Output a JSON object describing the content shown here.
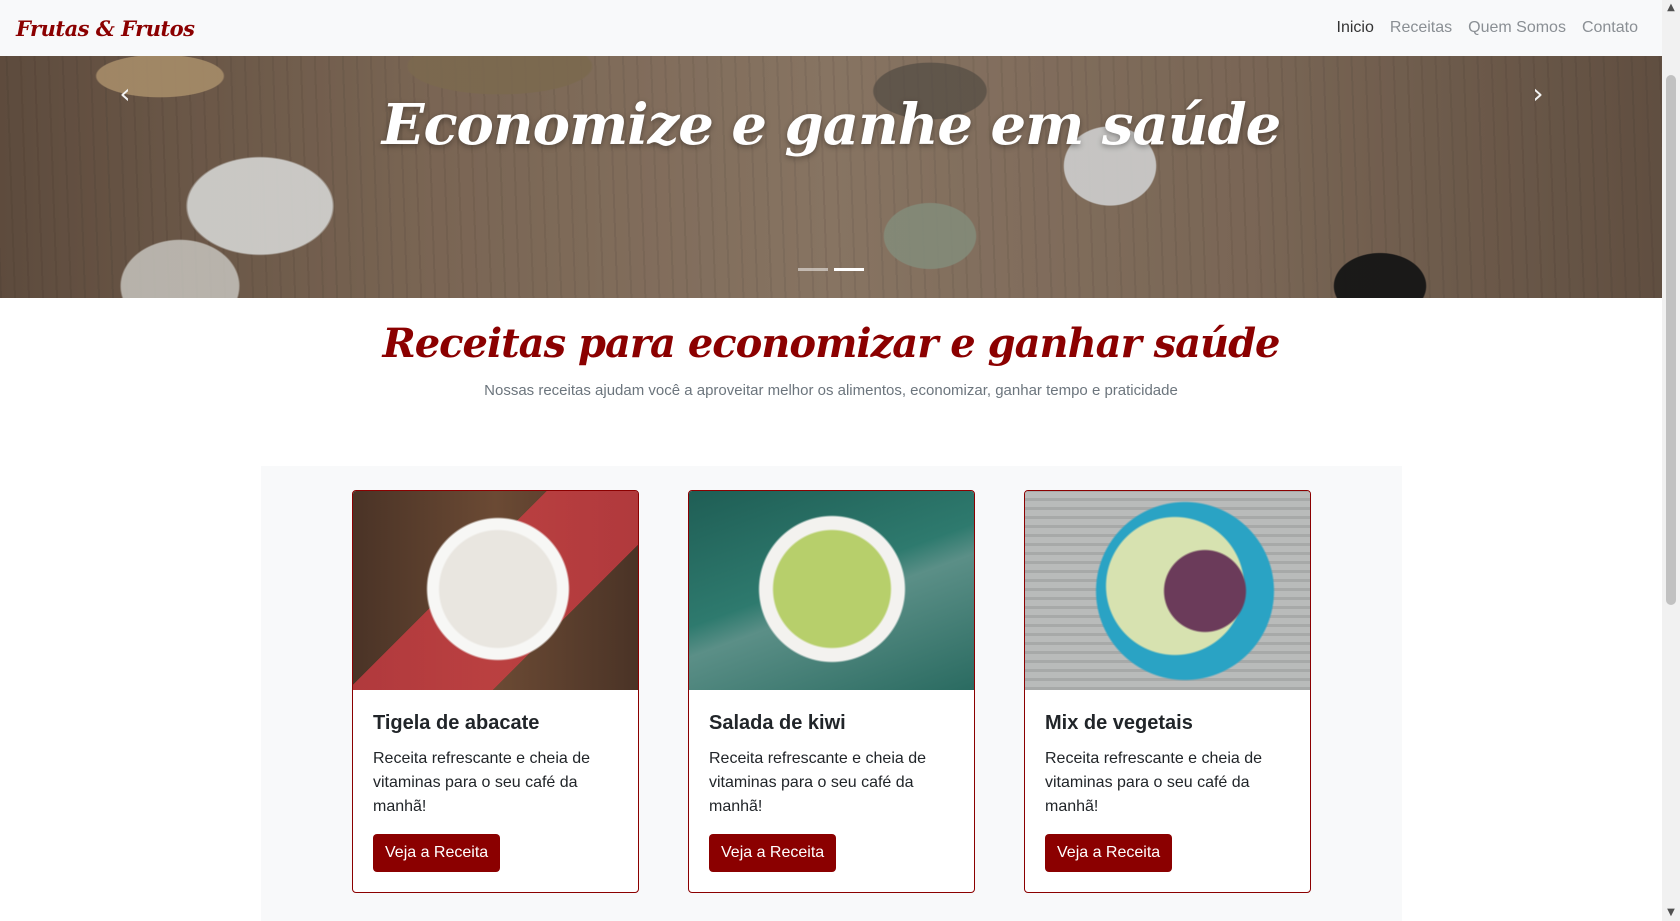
{
  "navbar": {
    "brand": "Frutas & Frutos",
    "links": [
      "Inicio",
      "Receitas",
      "Quem Somos",
      "Contato"
    ],
    "active_index": 0
  },
  "hero": {
    "title": "Economize e ganhe em saúde",
    "prev_icon": "‹",
    "next_icon": "›",
    "slides_count": 2,
    "active_slide": 1
  },
  "section": {
    "title": "Receitas para economizar e ganhar saúde",
    "subtitle": "Nossas receitas ajudam você a aproveitar melhor os alimentos, economizar, ganhar tempo e praticidade"
  },
  "cards": [
    {
      "title": "Tigela de abacate",
      "text": "Receita refrescante e cheia de vitaminas para o seu café da manhã!",
      "button": "Veja a Receita"
    },
    {
      "title": "Salada de kiwi",
      "text": "Receita refrescante e cheia de vitaminas para o seu café da manhã!",
      "button": "Veja a Receita"
    },
    {
      "title": "Mix de vegetais",
      "text": "Receita refrescante e cheia de vitaminas para o seu café da manhã!",
      "button": "Veja a Receita"
    }
  ],
  "colors": {
    "brand": "#8b0000",
    "navbar_bg": "#f8f9fa",
    "muted_text": "#6c757d"
  }
}
